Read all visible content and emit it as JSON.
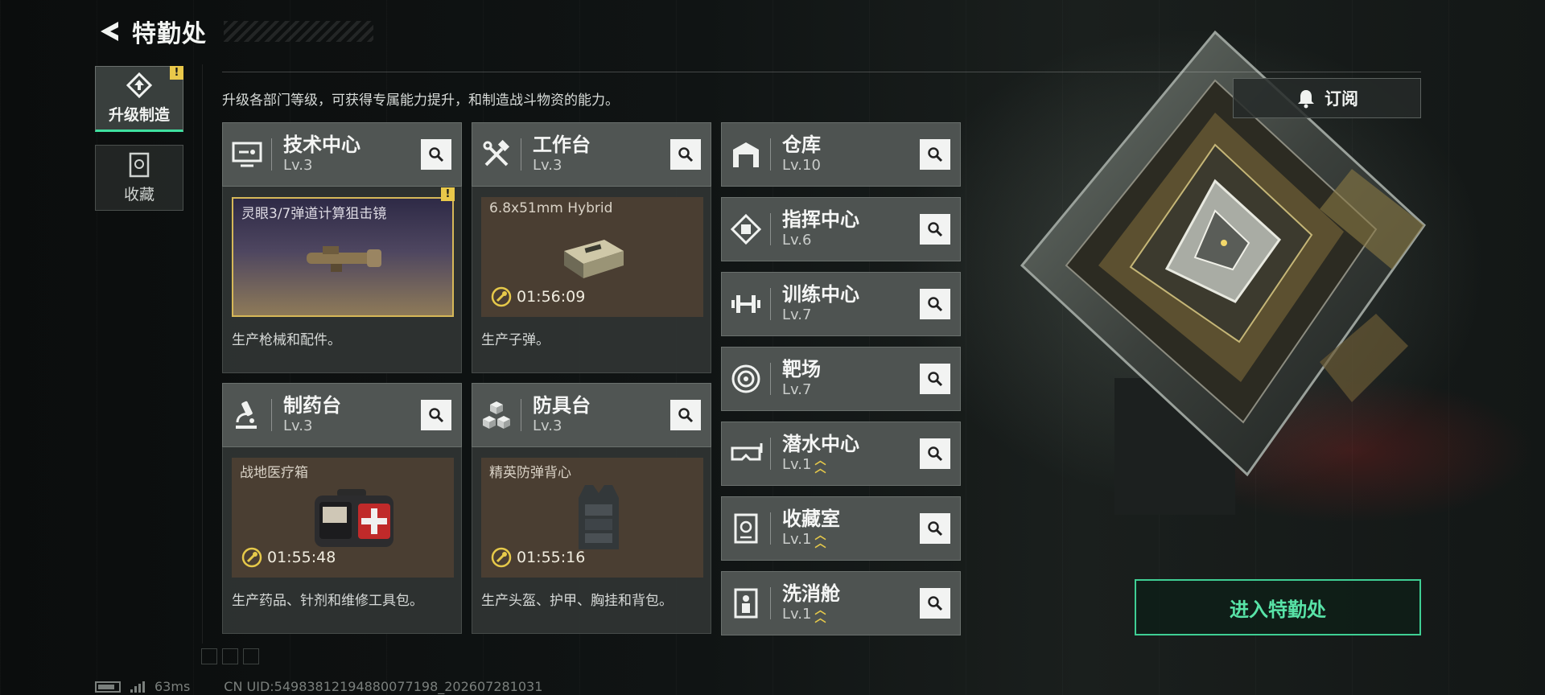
{
  "header": {
    "title": "特勤处"
  },
  "nav": [
    {
      "label": "升级制造",
      "active": true,
      "badge": "!"
    },
    {
      "label": "收藏",
      "active": false
    }
  ],
  "description": "升级各部门等级，可获得专属能力提升，和制造战斗物资的能力。",
  "subscribe": {
    "label": "订阅"
  },
  "departments": {
    "tech": {
      "name": "技术中心",
      "level": "Lv.3",
      "item": "灵眼3/7弹道计算狙击镜",
      "badge": "!",
      "desc": "生产枪械和配件。"
    },
    "workbench": {
      "name": "工作台",
      "level": "Lv.3",
      "item": "6.8x51mm Hybrid",
      "timer": "01:56:09",
      "desc": "生产子弹。"
    },
    "pharmacy": {
      "name": "制药台",
      "level": "Lv.3",
      "item": "战地医疗箱",
      "timer": "01:55:48",
      "desc": "生产药品、针剂和维修工具包。"
    },
    "armor": {
      "name": "防具台",
      "level": "Lv.3",
      "item": "精英防弹背心",
      "timer": "01:55:16",
      "desc": "生产头盔、护甲、胸挂和背包。"
    }
  },
  "facilities": [
    {
      "name": "仓库",
      "level": "Lv.10",
      "upgradable": false,
      "icon": "warehouse-icon"
    },
    {
      "name": "指挥中心",
      "level": "Lv.6",
      "upgradable": false,
      "icon": "chip-icon"
    },
    {
      "name": "训练中心",
      "level": "Lv.7",
      "upgradable": false,
      "icon": "dumbbell-icon"
    },
    {
      "name": "靶场",
      "level": "Lv.7",
      "upgradable": false,
      "icon": "target-icon"
    },
    {
      "name": "潜水中心",
      "level": "Lv.1",
      "upgradable": true,
      "icon": "diving-mask-icon"
    },
    {
      "name": "收藏室",
      "level": "Lv.1",
      "upgradable": true,
      "icon": "collection-icon"
    },
    {
      "name": "洗消舱",
      "level": "Lv.1",
      "upgradable": true,
      "icon": "decon-icon"
    }
  ],
  "enter": {
    "label": "进入特勤处"
  },
  "footer": {
    "ping": "63ms",
    "uid": "CN UID:5498381219488007719​8_202607281031"
  },
  "colors": {
    "accent": "#3fe0a0",
    "warning": "#e9c84a",
    "card": "#505553"
  }
}
